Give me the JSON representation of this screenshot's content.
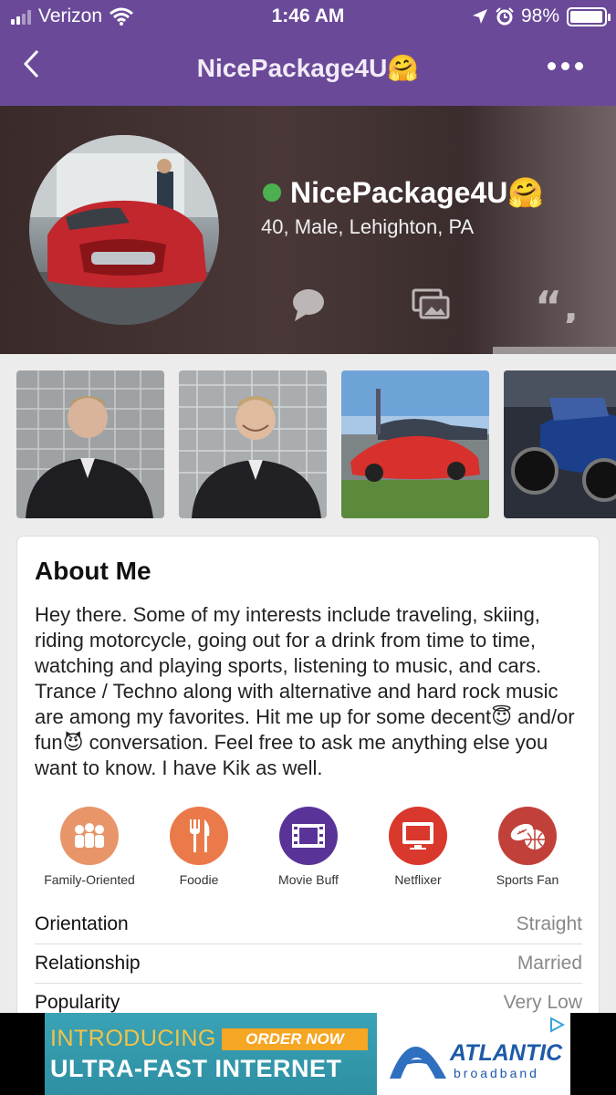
{
  "status_bar": {
    "carrier": "Verizon",
    "time": "1:46 AM",
    "battery": "98%",
    "battery_level": 0.98
  },
  "nav": {
    "back_icon": "chevron-left-icon",
    "title": "NicePackage4U🤗",
    "more_icon": "more-dots-icon"
  },
  "profile": {
    "name": "NicePackage4U🤗",
    "online_status_color": "#4cb050",
    "details": "40, Male, Lehighton, PA",
    "action_icons": [
      "chat-bubble-icon",
      "photos-icon",
      "quote-icon"
    ]
  },
  "photos": [
    "photo-man-suit-1",
    "photo-man-suit-2",
    "photo-red-car",
    "photo-motorcycle"
  ],
  "about": {
    "heading": "About Me",
    "text": "Hey there. Some of my interests include traveling, skiing, riding motorcycle, going out for a drink from time to time, watching and playing sports, listening to music, and cars. Trance / Techno along with alternative and hard rock music are among my favorites.  Hit me up for some decent😇 and/or fun😈 conversation. Feel free to ask me anything else you want to know.  I have Kik as well."
  },
  "interests": [
    {
      "label": "Family-Oriented",
      "icon": "family-icon",
      "color": "#e8956a"
    },
    {
      "label": "Foodie",
      "icon": "fork-knife-icon",
      "color": "#ea7a4a"
    },
    {
      "label": "Movie Buff",
      "icon": "film-icon",
      "color": "#5a3398"
    },
    {
      "label": "Netflixer",
      "icon": "tv-icon",
      "color": "#d9382c"
    },
    {
      "label": "Sports Fan",
      "icon": "sports-icon",
      "color": "#c1403a"
    }
  ],
  "details": [
    {
      "key": "Orientation",
      "value": "Straight"
    },
    {
      "key": "Relationship",
      "value": "Married"
    },
    {
      "key": "Popularity",
      "value": "Very Low"
    }
  ],
  "ad": {
    "introducing": "INTRODUCING",
    "order_now": "ORDER NOW",
    "headline": "ULTRA-FAST INTERNET",
    "brand": "ATLANTIC",
    "brand_sub": "broadband"
  },
  "colors": {
    "nav_purple": "#6a4a98"
  }
}
